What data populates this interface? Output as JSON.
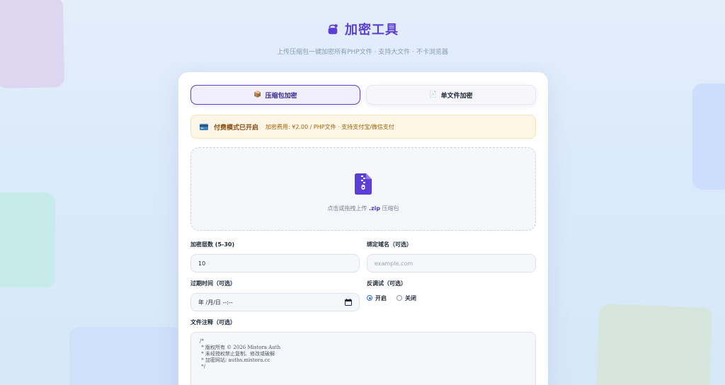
{
  "header": {
    "title": "加密工具",
    "subtitle": "上传压缩包一键加密所有PHP文件 · 支持大文件 · 不卡浏览器"
  },
  "tabs": [
    {
      "icon": "📦",
      "label": "压缩包加密",
      "active": true
    },
    {
      "icon": "📄",
      "label": "单文件加密",
      "active": false
    }
  ],
  "notice": {
    "title": "付费模式已开启",
    "text": "加密费用: ¥2.00 / PHP文件 · 支持支付宝/微信支付"
  },
  "dropzone": {
    "text_before": "点击或拖拽上传",
    "ext": ".zip",
    "text_after": "压缩包"
  },
  "form": {
    "layers_label": "加密层数 (5-30)",
    "layers_value": "10",
    "domain_label": "绑定域名（可选）",
    "domain_placeholder": "example.com",
    "expire_label": "过期时间（可选）",
    "expire_value": "年 /月/日 --:--",
    "debug_label": "反调试（可选）",
    "debug_on": "开启",
    "debug_off": "关闭",
    "debug_selected": "开启",
    "comment_label": "文件注释（可选）",
    "comment_value": "/*\n * 版权所有 © 2026 Mistora Auth\n * 未经授权禁止复制、修改或破解\n * 加密网站: auths.mistora.cc\n */"
  },
  "colors": {
    "accent": "#5b3fd6",
    "notice_bg": "#fdf6e6",
    "radio_on": "#2f6fe0"
  },
  "icons": [
    "bag-icon",
    "package-icon",
    "document-icon",
    "credit-card-icon",
    "zip-file-icon",
    "calendar-icon"
  ]
}
